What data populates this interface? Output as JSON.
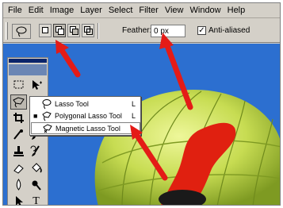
{
  "menu": {
    "items": [
      "File",
      "Edit",
      "Image",
      "Layer",
      "Select",
      "Filter",
      "View",
      "Window",
      "Help"
    ]
  },
  "options_bar": {
    "tool_preset_icon": "lasso-icon",
    "selection_modes": [
      "new-selection",
      "add-to-selection",
      "subtract-from-selection",
      "intersect-with-selection"
    ],
    "feather_label": "Feather:",
    "feather_value": "0 px",
    "anti_aliased_label": "Anti-aliased",
    "anti_aliased_checked": true,
    "anti_aliased_mark": "✓"
  },
  "toolbox": {
    "tools": [
      "marquee",
      "move",
      "lasso",
      "magic-wand",
      "crop",
      "slice",
      "healing-brush",
      "brush",
      "clone-stamp",
      "history-brush",
      "eraser",
      "paint-bucket",
      "blur",
      "dodge",
      "path-selection",
      "type",
      "pen",
      "shape"
    ],
    "type_tool_glyph": "T"
  },
  "flyout": {
    "items": [
      {
        "label": "Lasso Tool",
        "key": "L",
        "icon": "lasso-icon",
        "active": false
      },
      {
        "label": "Polygonal Lasso Tool",
        "key": "L",
        "icon": "polygonal-lasso-icon",
        "active": true
      },
      {
        "label": "Magnetic Lasso Tool",
        "key": "L",
        "icon": "magnetic-lasso-icon",
        "active": false
      }
    ],
    "active_marker": "■"
  },
  "colors": {
    "sky": "#2c6fd0",
    "balloon_yellow": "#d6e76a",
    "balloon_red": "#e02010",
    "annotation_arrow": "#e41b17",
    "chrome": "#d4d0c8"
  }
}
